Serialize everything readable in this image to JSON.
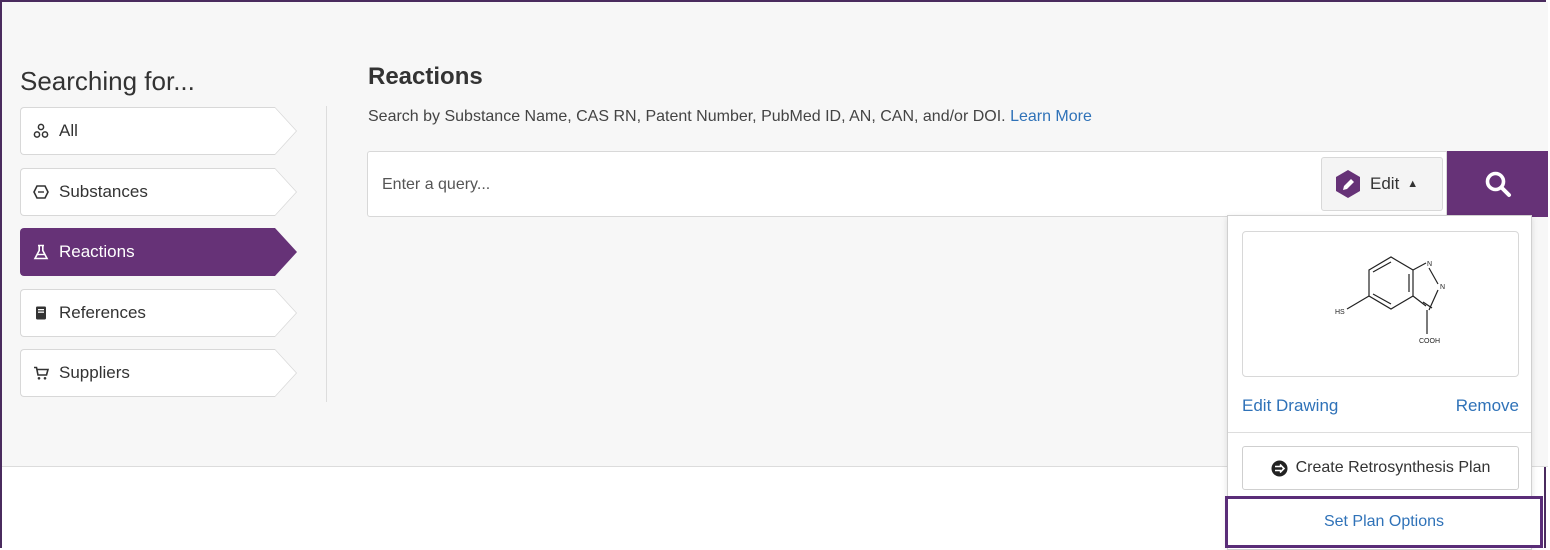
{
  "sidebar": {
    "title": "Searching for...",
    "items": [
      {
        "label": "All",
        "icon": "network-icon",
        "active": false
      },
      {
        "label": "Substances",
        "icon": "hexagon-icon",
        "active": false
      },
      {
        "label": "Reactions",
        "icon": "flask-icon",
        "active": true
      },
      {
        "label": "References",
        "icon": "book-icon",
        "active": false
      },
      {
        "label": "Suppliers",
        "icon": "cart-icon",
        "active": false
      }
    ]
  },
  "main": {
    "title": "Reactions",
    "help_text": "Search by Substance Name, CAS RN, Patent Number, PubMed ID, AN, CAN, and/or DOI.",
    "learn_more": "Learn More",
    "search": {
      "placeholder": "Enter a query...",
      "value": ""
    },
    "edit_label": "Edit"
  },
  "dropdown": {
    "edit_drawing": "Edit Drawing",
    "remove": "Remove",
    "retro_plan": "Create Retrosynthesis Plan",
    "plan_options": "Set Plan Options",
    "structure_labels": {
      "n1": "N",
      "n2": "N",
      "hs": "HS",
      "cooh": "COOH"
    }
  },
  "colors": {
    "accent": "#663277",
    "link": "#2f72b8",
    "highlight_border": "#5a2d78"
  }
}
